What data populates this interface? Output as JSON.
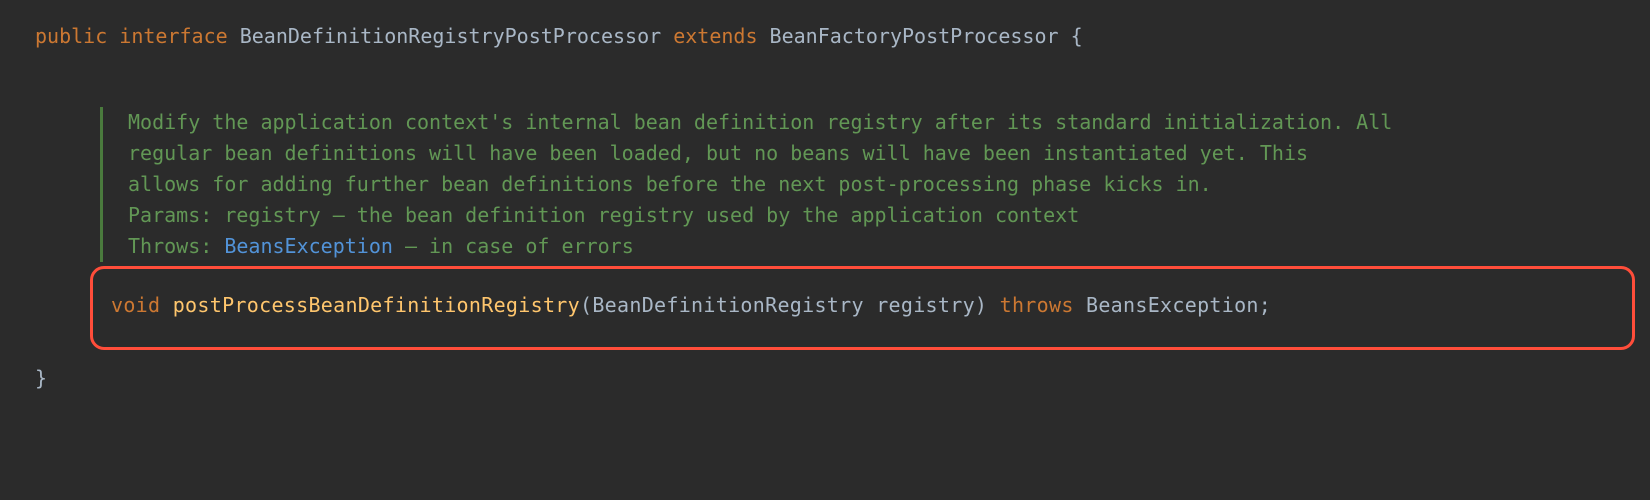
{
  "declaration": {
    "public": "public",
    "interface": "interface",
    "name": "BeanDefinitionRegistryPostProcessor",
    "extends": "extends",
    "parent": "BeanFactoryPostProcessor",
    "open_brace": "{",
    "close_brace": "}"
  },
  "javadoc": {
    "description_line1": "Modify the application context's internal bean definition registry after its standard initialization. All",
    "description_line2": "regular bean definitions will have been loaded, but no beans will have been instantiated yet. This",
    "description_line3": "allows for adding further bean definitions before the next post-processing phase kicks in.",
    "params_label": "Params:",
    "params_text": " registry – the bean definition registry used by the application context",
    "throws_label": "Throws:",
    "throws_exception": "BeansException",
    "throws_text": " – in case of errors"
  },
  "method": {
    "return_type": "void",
    "name": "postProcessBeanDefinitionRegistry",
    "param_type": "BeanDefinitionRegistry",
    "param_name": "registry",
    "throws": "throws",
    "exception": "BeansException",
    "open_paren": "(",
    "close_paren": ")",
    "semicolon": ";"
  }
}
